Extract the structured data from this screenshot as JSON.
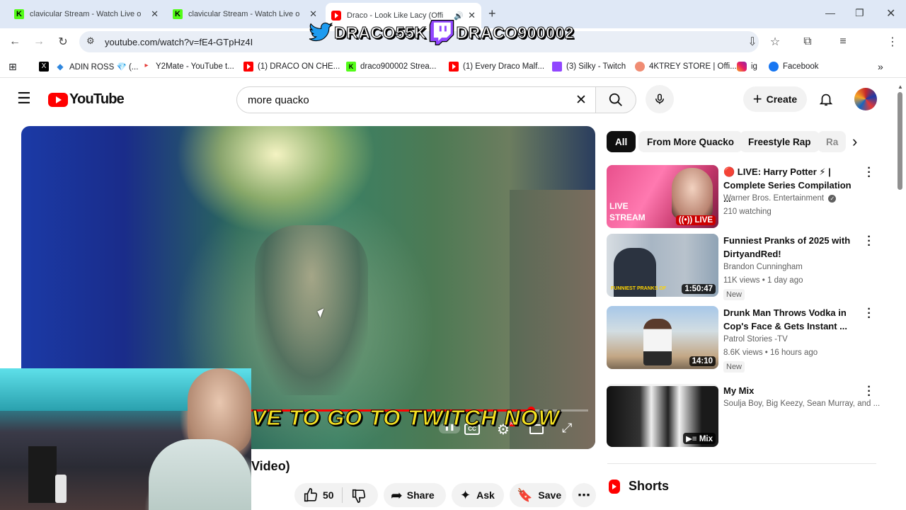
{
  "browser": {
    "tabs": [
      {
        "title": "clavicular Stream - Watch Live o",
        "favicon": "kick"
      },
      {
        "title": "clavicular Stream - Watch Live o",
        "favicon": "kick"
      },
      {
        "title": "Draco - Look Like Lacy (Offi",
        "favicon": "youtube",
        "active": true
      }
    ],
    "new_tab": "+",
    "url": "youtube.com/watch?v=fE4-GTpHz4I",
    "bookmarks": [
      {
        "label": "",
        "icon": "x-logo"
      },
      {
        "label": "ADIN ROSS 💎 (...",
        "icon": "diamond"
      },
      {
        "label": "Y2Mate - YouTube t...",
        "icon": "y2mate"
      },
      {
        "label": "(1) DRACO ON CHE...",
        "icon": "youtube"
      },
      {
        "label": "draco900002 Strea...",
        "icon": "kick"
      },
      {
        "label": "(1) Every Draco Malf...",
        "icon": "youtube"
      },
      {
        "label": "(3) Silky - Twitch",
        "icon": "twitch"
      },
      {
        "label": "4KTREY STORE | Offi...",
        "icon": "store"
      },
      {
        "label": "ig",
        "icon": "instagram"
      },
      {
        "label": "Facebook",
        "icon": "facebook"
      }
    ]
  },
  "overlay": {
    "twitter_handle": "DRACO55K",
    "twitch_handle": "DRACO900002"
  },
  "youtube": {
    "logo_text": "YouTube",
    "search_query": "more quacko",
    "create_label": "Create",
    "video": {
      "subtitle_overlay": "VE TO GO TO TWITCH NOW",
      "progress": 0.83,
      "title_visible": "Video)",
      "likes": "50",
      "share_label": "Share",
      "ask_label": "Ask",
      "save_label": "Save"
    },
    "chips": [
      "All",
      "From More Quacko",
      "Freestyle Rap",
      "Ra"
    ],
    "recommendations": [
      {
        "title": "🔴 LIVE: Harry Potter ⚡ | Complete Series Compilation ...",
        "channel": "Warner Bros. Entertainment",
        "verified": true,
        "meta": "210 watching",
        "badge": "LIVE",
        "thumb_text": "LIVE STREAM"
      },
      {
        "title": "Funniest Pranks of 2025 with DirtyandRed!",
        "channel": "Brandon Cunningham",
        "meta": "11K views • 1 day ago",
        "duration": "1:50:47",
        "new": "New",
        "thumb_text": "FUNNIEST PRANKS OF"
      },
      {
        "title": "Drunk Man Throws Vodka in Cop's Face & Gets Instant ...",
        "channel": "Patrol Stories -TV",
        "meta": "8.6K views • 16 hours ago",
        "duration": "14:10",
        "new": "New"
      },
      {
        "title": "My Mix",
        "channel": "Soulja Boy, Big Keezy, Sean Murray, and ...",
        "duration": "Mix"
      }
    ],
    "shorts_label": "Shorts"
  }
}
